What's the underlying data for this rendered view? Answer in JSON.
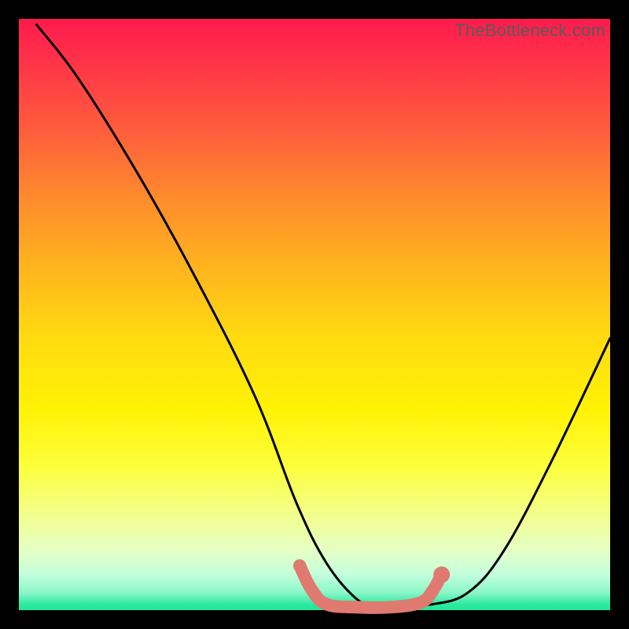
{
  "watermark": "TheBottleneck.com",
  "chart_data": {
    "type": "line",
    "title": "",
    "xlabel": "",
    "ylabel": "",
    "xlim": [
      0,
      100
    ],
    "ylim": [
      0,
      100
    ],
    "series": [
      {
        "name": "black-curve",
        "color": "#000000",
        "x": [
          3,
          10,
          20,
          30,
          40,
          47,
          52,
          57,
          60,
          65,
          70,
          76,
          82,
          90,
          100
        ],
        "y": [
          99,
          90,
          74,
          56,
          36,
          18,
          8,
          2,
          1,
          1,
          1,
          3,
          10,
          25,
          46
        ]
      },
      {
        "name": "coral-band",
        "color": "#e07a70",
        "x": [
          47.5,
          49.5,
          52,
          57,
          63,
          68,
          70,
          71.5
        ],
        "y": [
          7.5,
          3.5,
          1,
          0.5,
          0.5,
          1.3,
          3.3,
          6
        ]
      }
    ],
    "markers": [
      {
        "series": "coral-band",
        "x": 47.5,
        "y": 7.5,
        "r": 1.1
      },
      {
        "series": "coral-band",
        "x": 49.5,
        "y": 3.5,
        "r": 1.0
      },
      {
        "series": "coral-band",
        "x": 71.5,
        "y": 6.0,
        "r": 1.4
      }
    ]
  }
}
